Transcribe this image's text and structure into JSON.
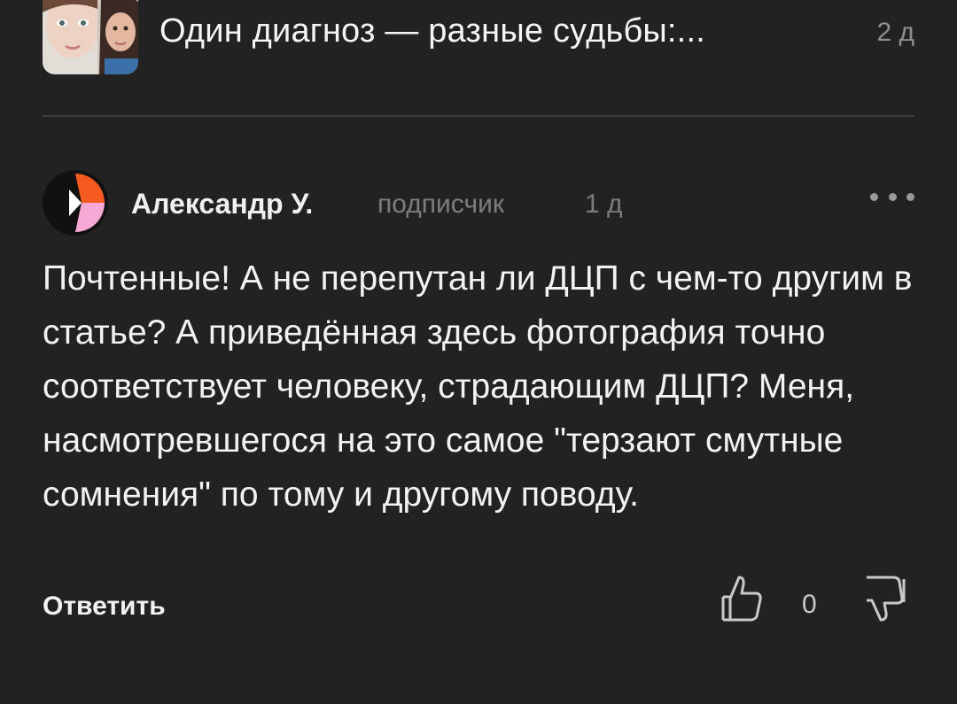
{
  "article": {
    "title": "Один диагноз — разные судьбы:...",
    "time": "2 д",
    "thumbnail": "article-thumbnail-photo"
  },
  "comment": {
    "author": "Александр У.",
    "role": "подписчик",
    "time": "1 д",
    "avatar_colors": {
      "background": "#111111",
      "orange": "#f55a1e",
      "pink": "#f6a9d4",
      "white": "#ffffff"
    },
    "text": "Почтенные! А не перепутан ли ДЦП с чем-то другим в статье? А приведённая здесь фотография точно соответствует человеку, страдающим ДЦП? Меня, насмотревшегося на это самое \"терзают смутные сомнения\" по тому и другому поводу.",
    "actions": {
      "reply_label": "Ответить",
      "like_count": "0",
      "like_icon": "thumb-up-icon",
      "dislike_icon": "thumb-down-icon",
      "more_icon": "more-dots-icon"
    }
  },
  "colors": {
    "background": "#222223",
    "text": "#f2f2f2",
    "muted": "#7d7d80",
    "divider": "#3c3c3e"
  }
}
